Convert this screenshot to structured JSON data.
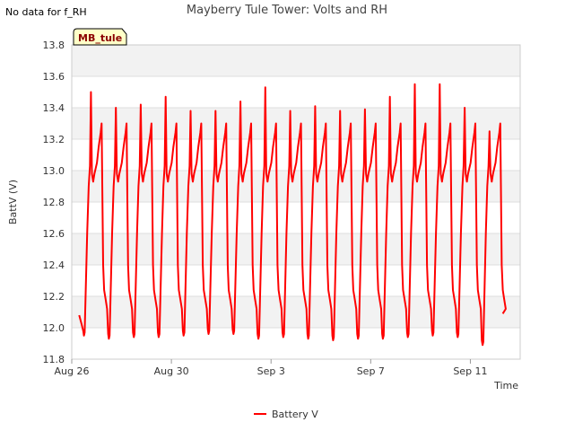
{
  "notice": "No data for f_RH",
  "chart_data": {
    "type": "line",
    "title": "Mayberry Tule Tower: Volts and RH",
    "xlabel": "Time",
    "ylabel": "BattV (V)",
    "site_label": "MB_tule",
    "ylim": [
      11.8,
      13.8
    ],
    "y_ticks": [
      "11.8",
      "12.0",
      "12.2",
      "12.4",
      "12.6",
      "12.8",
      "13.0",
      "13.2",
      "13.4",
      "13.6",
      "13.8"
    ],
    "xlim_days": [
      0,
      18
    ],
    "x_ticks": [
      {
        "day": 0,
        "label": "Aug 26"
      },
      {
        "day": 4,
        "label": "Aug 30"
      },
      {
        "day": 8,
        "label": "Sep 3"
      },
      {
        "day": 12,
        "label": "Sep 7"
      },
      {
        "day": 16,
        "label": "Sep 11"
      }
    ],
    "grid": true,
    "legend_position": "bottom-center",
    "series": [
      {
        "name": "Battery V",
        "color": "#ff0000",
        "x_start_day": 0.3,
        "x_end_day": 17.3,
        "daily": [
          {
            "min": 11.95,
            "peak": 13.5
          },
          {
            "min": 11.93,
            "peak": 13.4
          },
          {
            "min": 11.94,
            "peak": 13.42
          },
          {
            "min": 11.94,
            "peak": 13.47
          },
          {
            "min": 11.95,
            "peak": 13.38
          },
          {
            "min": 11.96,
            "peak": 13.38
          },
          {
            "min": 11.96,
            "peak": 13.44
          },
          {
            "min": 11.93,
            "peak": 13.53
          },
          {
            "min": 11.94,
            "peak": 13.38
          },
          {
            "min": 11.93,
            "peak": 13.41
          },
          {
            "min": 11.92,
            "peak": 13.38
          },
          {
            "min": 11.93,
            "peak": 13.39
          },
          {
            "min": 11.93,
            "peak": 13.47
          },
          {
            "min": 11.94,
            "peak": 13.55
          },
          {
            "min": 11.95,
            "peak": 13.55
          },
          {
            "min": 11.94,
            "peak": 13.4
          },
          {
            "min": 11.89,
            "peak": 13.25
          }
        ],
        "end_value": 12.09
      }
    ]
  }
}
